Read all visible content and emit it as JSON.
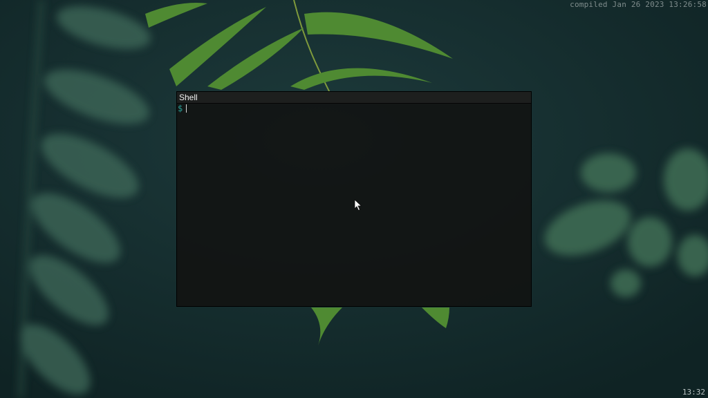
{
  "desktop": {
    "build_info": "compiled Jan 26 2023 13:26:58",
    "clock": "13:32",
    "icons": {
      "pointer": "mouse-pointer-icon"
    }
  },
  "shell_window": {
    "title": "Shell",
    "prompt_symbol": "$",
    "input_value": ""
  },
  "colors": {
    "background": "#142a2b",
    "prompt": "#2aa198",
    "title_text": "#f2f2f2"
  }
}
